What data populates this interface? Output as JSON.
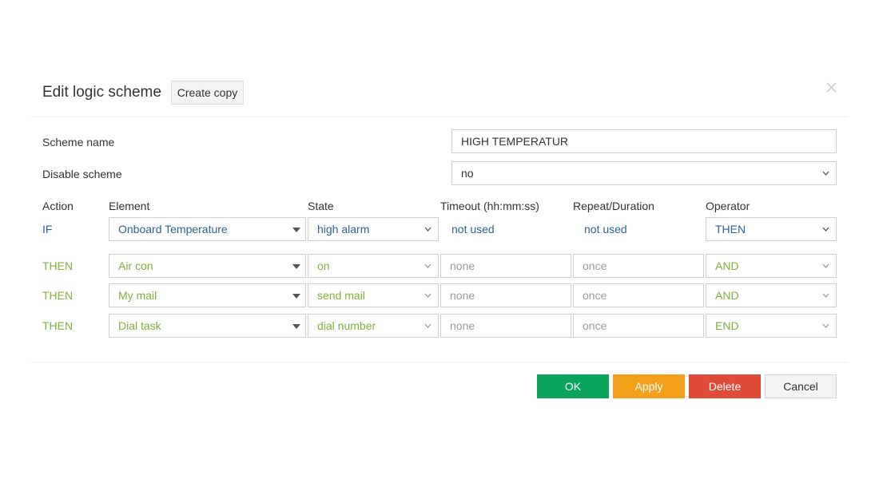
{
  "dialog": {
    "title": "Edit logic scheme",
    "create_copy_label": "Create copy"
  },
  "scheme_name": {
    "label": "Scheme name",
    "value": "HIGH TEMPERATUR"
  },
  "disable_scheme": {
    "label": "Disable scheme",
    "value": "no"
  },
  "columns": {
    "action": "Action",
    "element": "Element",
    "state": "State",
    "timeout": "Timeout (hh:mm:ss)",
    "repeat": "Repeat/Duration",
    "operator": "Operator"
  },
  "if_row": {
    "action": "IF",
    "element": "Onboard Temperature",
    "state": "high alarm",
    "timeout": "not used",
    "repeat": "not used",
    "operator": "THEN"
  },
  "then_rows": [
    {
      "action": "THEN",
      "element": "Air con",
      "state": "on",
      "timeout": "none",
      "repeat": "once",
      "operator": "AND"
    },
    {
      "action": "THEN",
      "element": "My mail",
      "state": "send mail",
      "timeout": "none",
      "repeat": "once",
      "operator": "AND"
    },
    {
      "action": "THEN",
      "element": "Dial task",
      "state": "dial number",
      "timeout": "none",
      "repeat": "once",
      "operator": "END"
    }
  ],
  "buttons": {
    "ok": "OK",
    "apply": "Apply",
    "delete": "Delete",
    "cancel": "Cancel"
  },
  "colors": {
    "if_text": "#2a6496",
    "then_text": "#7fb13a",
    "ok": "#0aa55b",
    "apply": "#f3a01a",
    "delete": "#de4b39",
    "cancel": "#f3f3f3"
  }
}
